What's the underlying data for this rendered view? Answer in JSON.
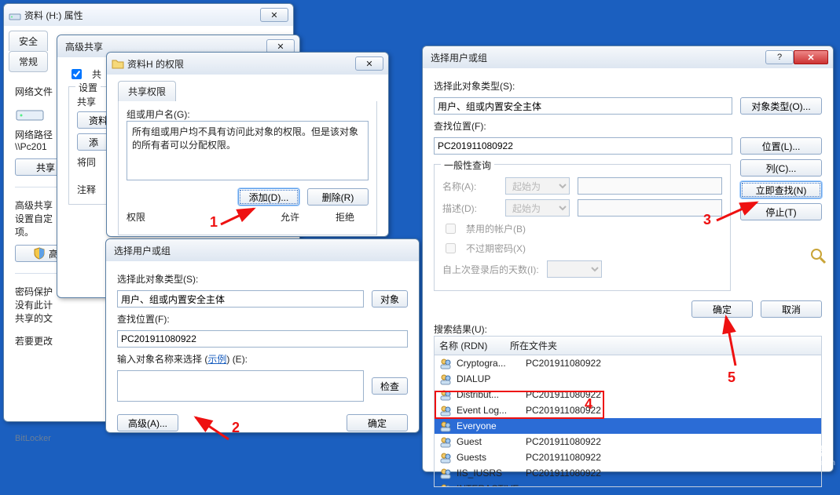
{
  "app_background": "#1b5fbf",
  "win_prop": {
    "title": "资料 (H:) 属性",
    "tabs": {
      "safety": "安全",
      "general": "常规"
    },
    "networkfile": "网络文件",
    "network_path_label": "网络路径",
    "network_path_value": "\\\\Pc201",
    "share_btn": "共享",
    "adv_share_title": "高级共享",
    "adv_share_sub": "设置自定",
    "adv_share_sub2": "项。",
    "adv_btn": "高",
    "pw_title": "密码保护",
    "pw_line1": "没有此计",
    "pw_line2": "共享的文",
    "pw_line3": "若要更改",
    "bitlocker": "BitLocker "
  },
  "win_advshare": {
    "title": "高级共享",
    "chk_share": "共",
    "settings_label": "设置",
    "share_name_label": "共享",
    "material_btn": "资料",
    "add_btn": "添",
    "copy_label": "将同",
    "note_label": "注释"
  },
  "win_perm": {
    "title": "资料H 的权限",
    "tab": "共享权限",
    "group_user_label": "组或用户名(G):",
    "group_note": "所有组或用户均不具有访问此对象的权限。但是该对象的所有者可以分配权限。",
    "add_btn": "添加(D)...",
    "remove_btn": "删除(R)",
    "perm_label": "权限",
    "allow": "允许",
    "deny": "拒绝"
  },
  "win_seluser_small": {
    "title": "选择用户或组",
    "sel_type_label": "选择此对象类型(S):",
    "type_value": "用户、组或内置安全主体",
    "type_btn": "对象",
    "lookup_loc_label": "查找位置(F):",
    "lookup_value": "PC201911080922",
    "input_label_pre": "输入对象名称来选择 (",
    "example_link": "示例",
    "input_label_post": ") (E):",
    "check_btn": "检查",
    "adv_btn": "高级(A)...",
    "ok_btn": "确定"
  },
  "win_seluser_big": {
    "title": "选择用户或组",
    "sel_type_label": "选择此对象类型(S):",
    "type_value": "用户、组或内置安全主体",
    "type_btn": "对象类型(O)...",
    "lookup_loc_label": "查找位置(F):",
    "lookup_value": "PC201911080922",
    "loc_btn": "位置(L)...",
    "general_query": "一般性查询",
    "name_label": "名称(A):",
    "desc_label": "描述(D):",
    "startswith": "起始为",
    "disabled_acct": "禁用的帐户(B)",
    "no_expire": "不过期密码(X)",
    "days_since_logon": "自上次登录后的天数(I):",
    "col_btn": "列(C)...",
    "findnow_btn": "立即查找(N)",
    "stop_btn": "停止(T)",
    "ok_btn": "确定",
    "cancel_btn": "取消",
    "results_label": "搜索结果(U):",
    "col_name": "名称 (RDN)",
    "col_folder": "所在文件夹",
    "rows": [
      {
        "name": "Cryptogra...",
        "folder": "PC201911080922"
      },
      {
        "name": "DIALUP",
        "folder": ""
      },
      {
        "name": "Distribut...",
        "folder": "PC201911080922"
      },
      {
        "name": "Event Log...",
        "folder": "PC201911080922"
      },
      {
        "name": "Everyone",
        "folder": ""
      },
      {
        "name": "Guest",
        "folder": "PC201911080922"
      },
      {
        "name": "Guests",
        "folder": "PC201911080922"
      },
      {
        "name": "IIS_IUSRS",
        "folder": "PC201911080922"
      },
      {
        "name": "INTERACTIVE",
        "folder": ""
      }
    ],
    "selected_index": 4
  },
  "annotations": {
    "1": "1",
    "2": "2",
    "3": "3",
    "4": "4",
    "5": "5"
  },
  "watermark": {
    "brand": "路由器",
    "url": "luyouqi.com"
  }
}
